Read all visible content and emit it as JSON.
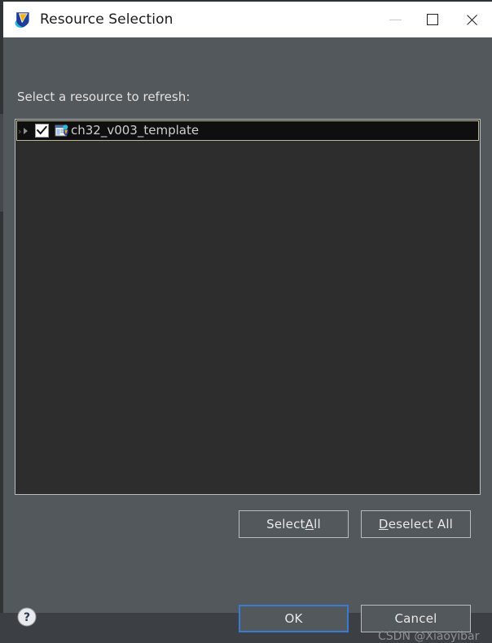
{
  "window": {
    "title": "Resource Selection",
    "icon": "mounriver-shield-check-icon",
    "controls": {
      "minimize": "minimize-icon",
      "maximize": "maximize-icon",
      "close": "close-icon"
    }
  },
  "dialog": {
    "prompt": "Select a resource to refresh:",
    "tree": {
      "items": [
        {
          "label": "ch32_v003_template",
          "checked": true,
          "expanded": false,
          "selected": true,
          "icon": "project-icon"
        }
      ]
    },
    "buttons": {
      "select_all": {
        "pre": "Select ",
        "mnemonic": "A",
        "post": "ll"
      },
      "deselect_all": {
        "pre": "",
        "mnemonic": "D",
        "post": "eselect All"
      },
      "ok": "OK",
      "cancel": "Cancel"
    },
    "help": {
      "icon": "help-question-icon",
      "label": "?"
    }
  },
  "watermark": "CSDN @Xiaoyibar",
  "colors": {
    "dialog_background": "#53585c",
    "titlebar_background": "#ffffff",
    "titlebar_text": "#1b1b1b",
    "tree_background": "#2d2d2d",
    "tree_border": "#b9bcbe",
    "selected_row_background": "#0f0f10",
    "selected_row_border": "#bdb79a",
    "button_border": "#b9bcbe",
    "button_text": "#e9e9e9",
    "default_button_focus": "#3a7bd0",
    "label_text": "#e2e2e2",
    "tree_label_text": "#cfcfcf",
    "watermark_text": "#8d9195"
  }
}
